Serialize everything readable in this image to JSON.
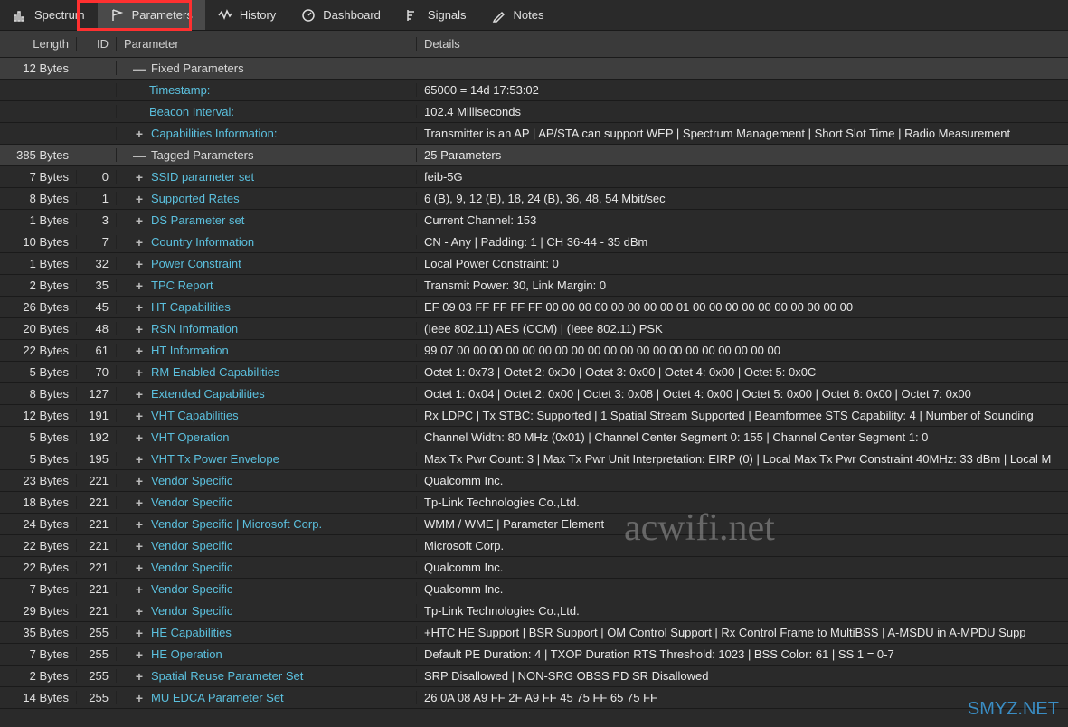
{
  "toolbar": {
    "tabs": [
      {
        "label": "Spectrum",
        "icon": "spectrum-icon"
      },
      {
        "label": "Parameters",
        "icon": "flag-icon",
        "active": true
      },
      {
        "label": "History",
        "icon": "history-icon"
      },
      {
        "label": "Dashboard",
        "icon": "dashboard-icon"
      },
      {
        "label": "Signals",
        "icon": "signals-icon"
      },
      {
        "label": "Notes",
        "icon": "notes-icon"
      }
    ]
  },
  "headers": {
    "length": "Length",
    "id": "ID",
    "parameter": "Parameter",
    "details": "Details"
  },
  "rows": [
    {
      "length": "12 Bytes",
      "id": "",
      "param": "Fixed Parameters",
      "details": "",
      "type": "section",
      "indent": 1,
      "exp": "minus",
      "link": false
    },
    {
      "length": "",
      "id": "",
      "param": "Timestamp:",
      "details": "65000 = 14d 17:53:02",
      "type": "item",
      "indent": 2,
      "exp": "",
      "link": true
    },
    {
      "length": "",
      "id": "",
      "param": "Beacon Interval:",
      "details": "102.4 Milliseconds",
      "type": "item",
      "indent": 2,
      "exp": "",
      "link": true
    },
    {
      "length": "",
      "id": "",
      "param": "Capabilities Information:",
      "details": "Transmitter is an AP   |   AP/STA can support WEP   |   Spectrum Management   |   Short Slot Time   |   Radio Measurement",
      "type": "item",
      "indent": 1,
      "exp": "plus",
      "link": true
    },
    {
      "length": "385 Bytes",
      "id": "",
      "param": "Tagged Parameters",
      "details": "25 Parameters",
      "type": "section",
      "indent": 1,
      "exp": "minus",
      "link": false
    },
    {
      "length": "7 Bytes",
      "id": "0",
      "param": "SSID parameter set",
      "details": "feib-5G",
      "type": "item",
      "indent": 1,
      "exp": "plus",
      "link": true
    },
    {
      "length": "8 Bytes",
      "id": "1",
      "param": "Supported Rates",
      "details": "6 (B), 9, 12 (B), 18, 24 (B), 36, 48, 54  Mbit/sec",
      "type": "item",
      "indent": 1,
      "exp": "plus",
      "link": true
    },
    {
      "length": "1 Bytes",
      "id": "3",
      "param": "DS Parameter set",
      "details": "Current Channel: 153",
      "type": "item",
      "indent": 1,
      "exp": "plus",
      "link": true
    },
    {
      "length": "10 Bytes",
      "id": "7",
      "param": "Country Information",
      "details": "CN  -  Any   |   Padding: 1   |   CH 36-44  -  35 dBm",
      "type": "item",
      "indent": 1,
      "exp": "plus",
      "link": true
    },
    {
      "length": "1 Bytes",
      "id": "32",
      "param": "Power Constraint",
      "details": "Local Power Constraint: 0",
      "type": "item",
      "indent": 1,
      "exp": "plus",
      "link": true
    },
    {
      "length": "2 Bytes",
      "id": "35",
      "param": "TPC Report",
      "details": "Transmit Power: 30, Link Margin: 0",
      "type": "item",
      "indent": 1,
      "exp": "plus",
      "link": true
    },
    {
      "length": "26 Bytes",
      "id": "45",
      "param": "HT Capabilities",
      "details": "EF 09 03 FF FF FF FF 00 00 00 00 00 00 00 00 01 00 00 00 00 00 00 00 00 00 00",
      "type": "item",
      "indent": 1,
      "exp": "plus",
      "link": true
    },
    {
      "length": "20 Bytes",
      "id": "48",
      "param": "RSN Information",
      "details": "(Ieee 802.11) AES (CCM)  |  (Ieee 802.11) PSK",
      "type": "item",
      "indent": 1,
      "exp": "plus",
      "link": true
    },
    {
      "length": "22 Bytes",
      "id": "61",
      "param": "HT Information",
      "details": "99 07 00 00 00 00 00 00 00 00 00 00 00 00 00 00 00 00 00 00 00 00",
      "type": "item",
      "indent": 1,
      "exp": "plus",
      "link": true
    },
    {
      "length": "5 Bytes",
      "id": "70",
      "param": "RM Enabled Capabilities",
      "details": "Octet 1:  0x73   |   Octet 2:  0xD0   |   Octet 3:  0x00   |   Octet 4:  0x00   |   Octet 5:  0x0C",
      "type": "item",
      "indent": 1,
      "exp": "plus",
      "link": true
    },
    {
      "length": "8 Bytes",
      "id": "127",
      "param": "Extended Capabilities",
      "details": "Octet 1:  0x04   |   Octet 2:  0x00   |   Octet 3:  0x08   |   Octet 4:  0x00   |   Octet 5:  0x00   |   Octet 6:  0x00   |   Octet 7:  0x00",
      "type": "item",
      "indent": 1,
      "exp": "plus",
      "link": true
    },
    {
      "length": "12 Bytes",
      "id": "191",
      "param": "VHT Capabilities",
      "details": "Rx LDPC   |   Tx STBC: Supported   |   1 Spatial Stream Supported   |   Beamformee STS Capability: 4   |   Number of Sounding",
      "type": "item",
      "indent": 1,
      "exp": "plus",
      "link": true
    },
    {
      "length": "5 Bytes",
      "id": "192",
      "param": "VHT Operation",
      "details": "Channel Width: 80 MHz (0x01)   |   Channel Center Segment 0: 155   |   Channel Center Segment 1: 0",
      "type": "item",
      "indent": 1,
      "exp": "plus",
      "link": true
    },
    {
      "length": "5 Bytes",
      "id": "195",
      "param": "VHT Tx Power Envelope",
      "details": "Max Tx Pwr Count: 3   |   Max Tx Pwr Unit Interpretation: EIRP (0)   |   Local Max Tx Pwr Constraint 40MHz: 33 dBm   |   Local M",
      "type": "item",
      "indent": 1,
      "exp": "plus",
      "link": true
    },
    {
      "length": "23 Bytes",
      "id": "221",
      "param": "Vendor Specific",
      "details": "Qualcomm Inc.",
      "type": "item",
      "indent": 1,
      "exp": "plus",
      "link": true
    },
    {
      "length": "18 Bytes",
      "id": "221",
      "param": "Vendor Specific",
      "details": "Tp-Link Technologies Co.,Ltd.",
      "type": "item",
      "indent": 1,
      "exp": "plus",
      "link": true
    },
    {
      "length": "24 Bytes",
      "id": "221",
      "param": "Vendor Specific   |   Microsoft Corp.",
      "details": "WMM / WME   |   Parameter Element",
      "type": "item",
      "indent": 1,
      "exp": "plus",
      "link": true
    },
    {
      "length": "22 Bytes",
      "id": "221",
      "param": "Vendor Specific",
      "details": "Microsoft Corp.",
      "type": "item",
      "indent": 1,
      "exp": "plus",
      "link": true
    },
    {
      "length": "22 Bytes",
      "id": "221",
      "param": "Vendor Specific",
      "details": "Qualcomm Inc.",
      "type": "item",
      "indent": 1,
      "exp": "plus",
      "link": true
    },
    {
      "length": "7 Bytes",
      "id": "221",
      "param": "Vendor Specific",
      "details": "Qualcomm Inc.",
      "type": "item",
      "indent": 1,
      "exp": "plus",
      "link": true
    },
    {
      "length": "29 Bytes",
      "id": "221",
      "param": "Vendor Specific",
      "details": "Tp-Link Technologies Co.,Ltd.",
      "type": "item",
      "indent": 1,
      "exp": "plus",
      "link": true
    },
    {
      "length": "35 Bytes",
      "id": "255",
      "param": "HE Capabilities",
      "details": "+HTC HE Support   |   BSR Support   |   OM Control Support   |   Rx Control Frame to MultiBSS   |   A-MSDU in A-MPDU Supp",
      "type": "item",
      "indent": 1,
      "exp": "plus",
      "link": true
    },
    {
      "length": "7 Bytes",
      "id": "255",
      "param": "HE Operation",
      "details": "Default PE Duration: 4   |   TXOP Duration RTS Threshold: 1023   |   BSS Color: 61   |   SS 1 = 0-7",
      "type": "item",
      "indent": 1,
      "exp": "plus",
      "link": true
    },
    {
      "length": "2 Bytes",
      "id": "255",
      "param": "Spatial Reuse Parameter Set",
      "details": "SRP Disallowed   |   NON-SRG OBSS PD SR Disallowed",
      "type": "item",
      "indent": 1,
      "exp": "plus",
      "link": true
    },
    {
      "length": "14 Bytes",
      "id": "255",
      "param": "MU EDCA Parameter Set",
      "details": "26 0A 08 A9 FF 2F A9 FF 45 75 FF 65 75 FF",
      "type": "item",
      "indent": 1,
      "exp": "plus",
      "link": true
    }
  ],
  "watermark": "acwifi.net",
  "watermark2": "SMYZ.NET"
}
